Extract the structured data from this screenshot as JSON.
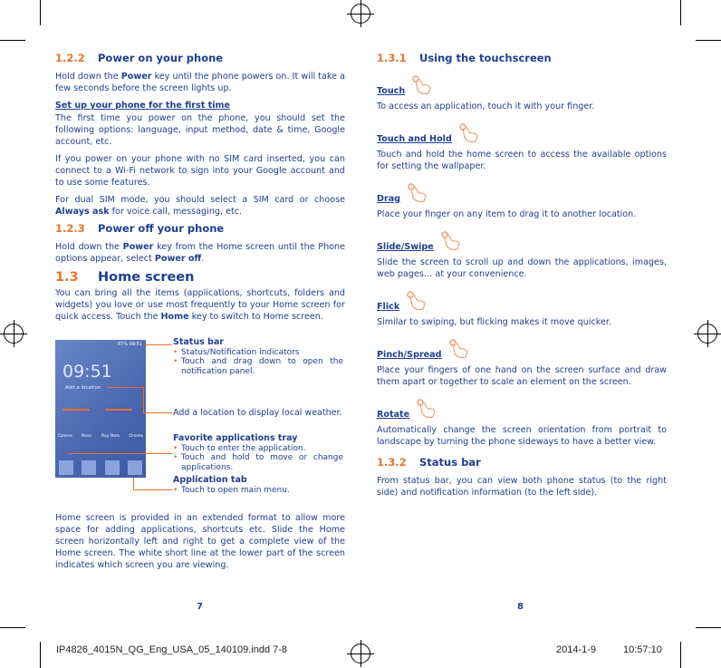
{
  "left": {
    "s122": {
      "num": "1.2.2",
      "title": "Power on your phone"
    },
    "p1a": "Hold down the ",
    "p1b": "Power",
    "p1c": " key until the phone powers on. It will take a few seconds before the screen lights up.",
    "setup": "Set up your phone for the first time",
    "p2": "The first time you power on the phone, you should set the following options: language, input method, date & time, Google account, etc.",
    "p3": "If you power on your phone with no SIM card inserted, you can connect to a Wi-Fi network to sign into your Google account and to use some features.",
    "p4a": "For dual SIM mode, you should select a SIM card or choose ",
    "p4b": "Always ask",
    "p4c": " for voice call, messaging, etc.",
    "s123": {
      "num": "1.2.3",
      "title": "Power off your phone"
    },
    "p5a": "Hold down the ",
    "p5b": "Power",
    "p5c": " key from the Home screen until the Phone options appear, select ",
    "p5d": "Power off",
    "p5e": ".",
    "s13": {
      "num": "1.3",
      "title": "Home screen"
    },
    "p6a": "You can bring all the items (applications, shortcuts, folders and widgets) you love or use most frequently to your Home screen for quick access. Touch the ",
    "p6b": "Home",
    "p6c": " key to switch to Home screen.",
    "phone": {
      "clock": "09:51",
      "add_location": "Add a location",
      "status": "87% 09:51",
      "apps": [
        "Camera",
        "Music",
        "Play Store",
        "Chrome"
      ]
    },
    "ann": {
      "status_title": "Status bar",
      "status_items": [
        "Status/Notification indicators",
        "Touch and drag down to open the notification panel."
      ],
      "weather": "Add a location to display local weather.",
      "fav_title": "Favorite applications tray",
      "fav_items": [
        "Touch to enter the application.",
        "Touch and hold to move or change applications."
      ],
      "app_title": "Application tab",
      "app_items": [
        "Touch to open main menu."
      ]
    },
    "p7": "Home screen is provided in an extended format to allow more space for adding applications, shortcuts etc. Slide the Home screen horizontally left and right to get a complete view of the Home screen. The white short line at the lower part of the screen indicates which screen you are viewing.",
    "page": "7"
  },
  "right": {
    "s131": {
      "num": "1.3.1",
      "title": "Using the touchscreen"
    },
    "gestures": [
      {
        "name": "Touch",
        "icon": "touch-hand-icon",
        "desc": "To access an application, touch it with your finger."
      },
      {
        "name": "Touch and Hold",
        "icon": "touch-hold-hand-icon",
        "desc": "Touch and hold the home screen to access the available options for setting the wallpaper."
      },
      {
        "name": "Drag",
        "icon": "drag-hand-icon",
        "desc": "Place your finger on any item to drag it to another location."
      },
      {
        "name": "Slide/Swipe",
        "icon": "swipe-hand-icon",
        "desc": "Slide the screen to scroll up and down the applications, images, web pages… at your convenience."
      },
      {
        "name": "Flick",
        "icon": "flick-hand-icon",
        "desc": "Similar to swiping, but flicking makes it move quicker."
      },
      {
        "name": "Pinch/Spread",
        "icon": "pinch-hand-icon",
        "desc": "Place your fingers of one hand on the screen surface and draw them apart or together to scale an element on the screen."
      },
      {
        "name": "Rotate",
        "icon": "rotate-icon",
        "desc": "Automatically change the screen orientation from portrait to landscape by turning the phone sideways to have a better view."
      }
    ],
    "s132": {
      "num": "1.3.2",
      "title": "Status bar"
    },
    "p1": "From status bar, you can view both phone status (to the right side) and notification information (to the left side).",
    "page": "8"
  },
  "footer": {
    "file": "IP4826_4015N_QG_Eng_USA_05_140109.indd   7-8",
    "date": "2014-1-9",
    "time": "10:57:10"
  },
  "colors": {
    "text": "#1e3f8f",
    "accent": "#e8732a"
  }
}
